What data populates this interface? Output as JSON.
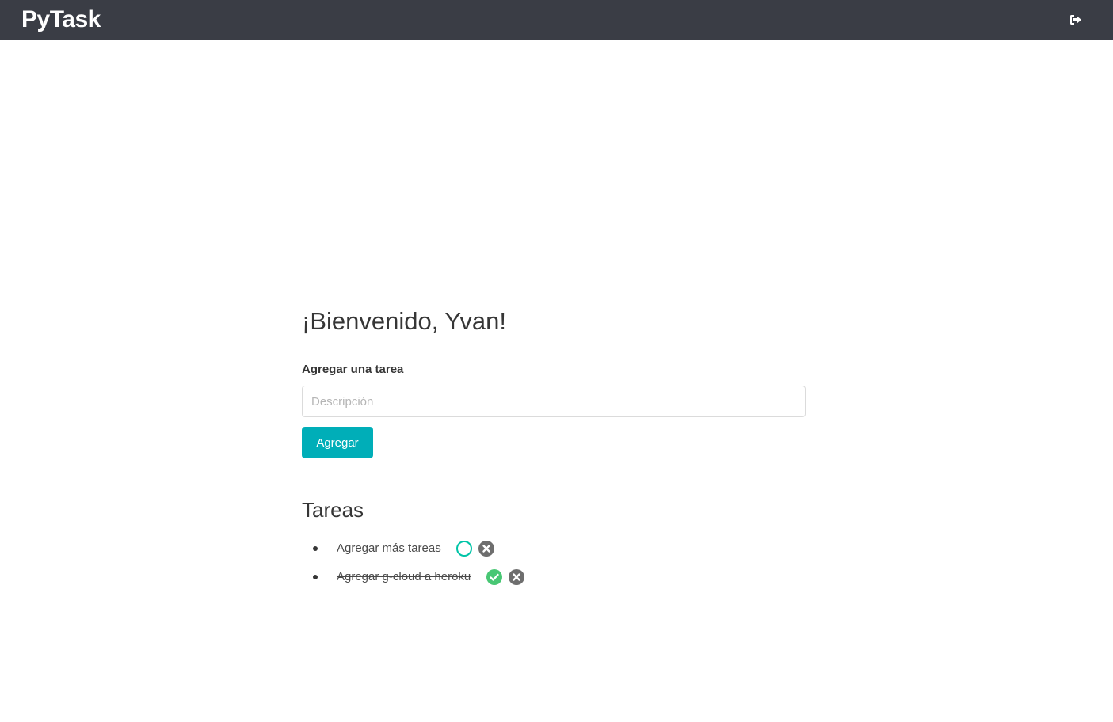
{
  "navbar": {
    "brand": "PyTask",
    "logout_icon": "sign-out-icon"
  },
  "main": {
    "welcome": "¡Bienvenido, Yvan!",
    "form": {
      "label": "Agregar una tarea",
      "placeholder": "Descripción",
      "value": "",
      "button_label": "Agregar"
    },
    "tasks_title": "Tareas",
    "tasks": [
      {
        "text": "Agregar más tareas",
        "done": false,
        "status_icon": "circle-outline-icon",
        "delete_icon": "times-circle-icon"
      },
      {
        "text": "Agregar g-cloud a heroku",
        "done": true,
        "status_icon": "check-circle-icon",
        "delete_icon": "times-circle-icon"
      }
    ]
  },
  "colors": {
    "navbar_bg": "#3a3d45",
    "primary": "#00aeb8",
    "pending": "#00c4a7",
    "done": "#48c774",
    "delete": "#6e6e6e"
  }
}
